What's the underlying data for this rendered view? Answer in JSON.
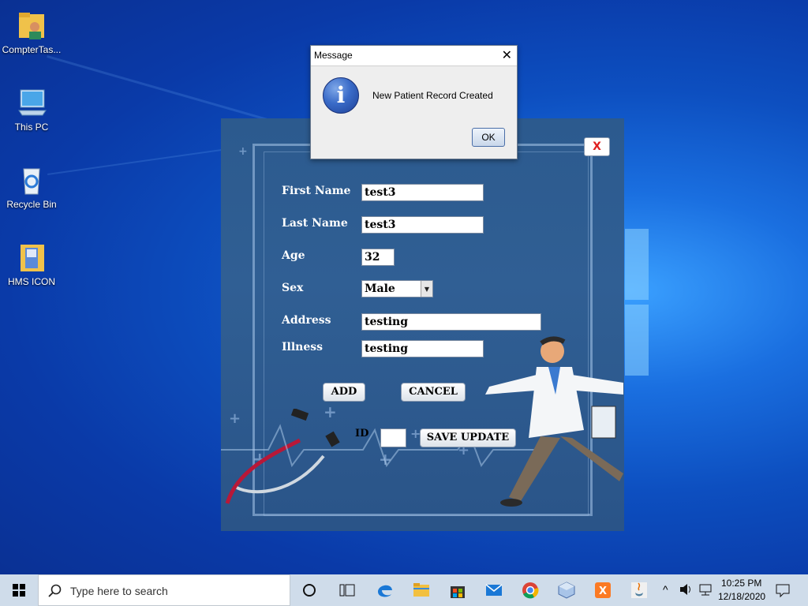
{
  "desktop": {
    "icons": [
      {
        "label": "CompterTas..."
      },
      {
        "label": "This PC"
      },
      {
        "label": "Recycle Bin"
      },
      {
        "label": "HMS ICON"
      }
    ]
  },
  "app": {
    "close_label": "X",
    "fields": {
      "first_name": {
        "label": "First Name",
        "value": "test3"
      },
      "last_name": {
        "label": "Last Name",
        "value": "test3"
      },
      "age": {
        "label": "Age",
        "value": "32"
      },
      "sex": {
        "label": "Sex",
        "value": "Male"
      },
      "address": {
        "label": "Address",
        "value": "testing"
      },
      "illness": {
        "label": "Illness",
        "value": "testing"
      },
      "id": {
        "label": "ID",
        "value": ""
      }
    },
    "buttons": {
      "add": "ADD",
      "cancel": "CANCEL",
      "save_update": "SAVE UPDATE"
    }
  },
  "dialog": {
    "title": "Message",
    "message": "New Patient Record Created",
    "ok_label": "OK",
    "icon": "info-icon"
  },
  "taskbar": {
    "search_placeholder": "Type here to search",
    "apps": [
      "task-view-icon",
      "edge-icon",
      "file-explorer-icon",
      "store-icon",
      "mail-icon",
      "chrome-icon",
      "virtualbox-icon",
      "xampp-icon",
      "java-icon"
    ],
    "time": "10:25 PM",
    "date": "12/18/2020"
  }
}
